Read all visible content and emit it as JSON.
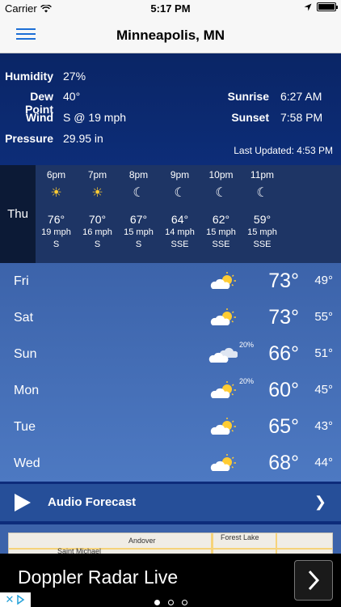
{
  "status_bar": {
    "carrier": "Carrier",
    "time": "5:17 PM"
  },
  "nav": {
    "title": "Minneapolis, MN"
  },
  "current": {
    "humidity_label": "Humidity",
    "humidity": "27%",
    "dewpoint_label": "Dew Point",
    "dewpoint": "40°",
    "wind_label": "Wind",
    "wind": "S @ 19 mph",
    "pressure_label": "Pressure",
    "pressure": "29.95 in",
    "sunrise_label": "Sunrise",
    "sunrise": "6:27 AM",
    "sunset_label": "Sunset",
    "sunset": "7:58 PM",
    "last_updated": "Last Updated: 4:53 PM"
  },
  "hourly": {
    "day": "Thu",
    "hours": [
      {
        "time": "6pm",
        "icon": "sun-icon",
        "temp": "76°",
        "wind": "19 mph",
        "dir": "S"
      },
      {
        "time": "7pm",
        "icon": "sun-icon",
        "temp": "70°",
        "wind": "16 mph",
        "dir": "S"
      },
      {
        "time": "8pm",
        "icon": "moon-icon",
        "temp": "67°",
        "wind": "15 mph",
        "dir": "S"
      },
      {
        "time": "9pm",
        "icon": "moon-icon",
        "temp": "64°",
        "wind": "14 mph",
        "dir": "SSE"
      },
      {
        "time": "10pm",
        "icon": "moon-icon",
        "temp": "62°",
        "wind": "15 mph",
        "dir": "SSE"
      },
      {
        "time": "11pm",
        "icon": "moon-icon",
        "temp": "59°",
        "wind": "15 mph",
        "dir": "SSE"
      }
    ]
  },
  "daily": [
    {
      "day": "Fri",
      "icon": "partly-cloudy-icon",
      "precip": "",
      "hi": "73°",
      "lo": "49°"
    },
    {
      "day": "Sat",
      "icon": "partly-cloudy-icon",
      "precip": "",
      "hi": "73°",
      "lo": "55°"
    },
    {
      "day": "Sun",
      "icon": "cloudy-icon",
      "precip": "20%",
      "hi": "66°",
      "lo": "51°"
    },
    {
      "day": "Mon",
      "icon": "partly-cloudy-icon",
      "precip": "20%",
      "hi": "60°",
      "lo": "45°"
    },
    {
      "day": "Tue",
      "icon": "partly-cloudy-icon",
      "precip": "",
      "hi": "65°",
      "lo": "43°"
    },
    {
      "day": "Wed",
      "icon": "partly-cloudy-icon",
      "precip": "",
      "hi": "68°",
      "lo": "44°"
    }
  ],
  "audio": {
    "label": "Audio Forecast"
  },
  "map": {
    "labels": [
      "Andover",
      "Forest Lake",
      "Saint Michael"
    ]
  },
  "ad": {
    "text": "Doppler Radar Live"
  },
  "colors": {
    "accent": "#1d6fd6",
    "header_bg": "#0a2566",
    "daily_bg": "#3c63aa",
    "sun": "#ffcc33"
  }
}
